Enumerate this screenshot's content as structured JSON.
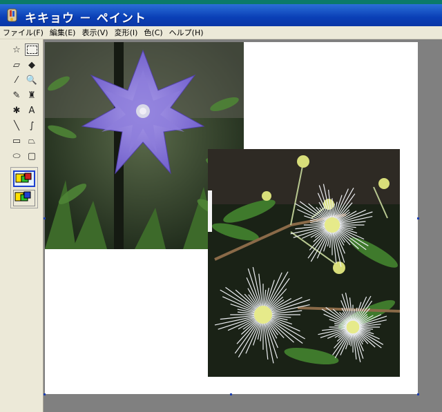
{
  "window": {
    "title": "キキョウ － ペイント"
  },
  "menu": [
    "ファイル(F)",
    "編集(E)",
    "表示(V)",
    "変形(I)",
    "色(C)",
    "ヘルプ(H)"
  ],
  "tools": [
    {
      "name": "free-select-icon",
      "glyph": "☆"
    },
    {
      "name": "rect-select-icon",
      "glyph": "",
      "selected": true
    },
    {
      "name": "eraser-icon",
      "glyph": "▱"
    },
    {
      "name": "fill-bucket-icon",
      "glyph": "◆"
    },
    {
      "name": "color-picker-icon",
      "glyph": "⁄"
    },
    {
      "name": "magnifier-icon",
      "glyph": "🔍"
    },
    {
      "name": "pencil-icon",
      "glyph": "✎"
    },
    {
      "name": "brush-icon",
      "glyph": "♜"
    },
    {
      "name": "airbrush-icon",
      "glyph": "✱"
    },
    {
      "name": "text-icon",
      "glyph": "A"
    },
    {
      "name": "line-icon",
      "glyph": "╲"
    },
    {
      "name": "curve-icon",
      "glyph": "∫"
    },
    {
      "name": "rectangle-icon",
      "glyph": "▭"
    },
    {
      "name": "polygon-icon",
      "glyph": "⏢"
    },
    {
      "name": "ellipse-icon",
      "glyph": "⬭"
    },
    {
      "name": "rounded-rect-icon",
      "glyph": "▢"
    }
  ],
  "colors": {
    "title_bar": "#0a3fb6",
    "menu_bg": "#ece9d8",
    "workspace": "#808080",
    "selection_handle": "#1d3fb0"
  }
}
